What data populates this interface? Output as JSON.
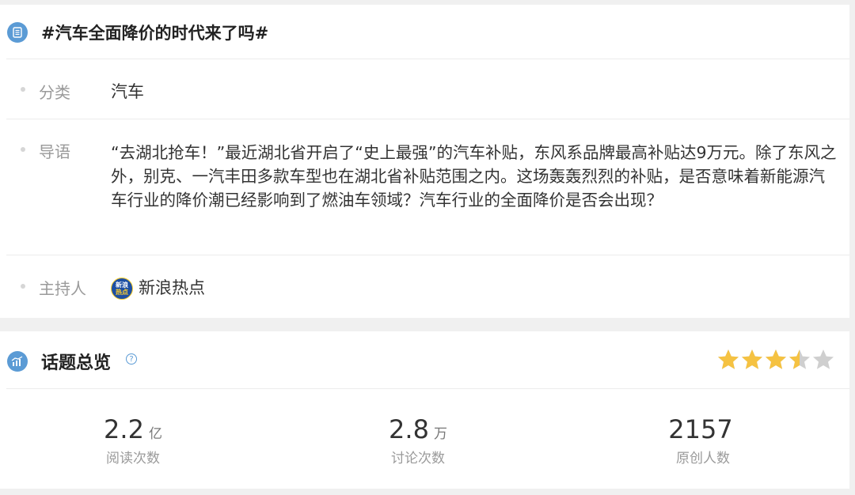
{
  "topic": {
    "title": "#汽车全面降价的时代来了吗#",
    "category_label": "分类",
    "category_value": "汽车",
    "intro_label": "导语",
    "intro_text": "“去湖北抢车！”最近湖北省开启了“史上最强”的汽车补贴，东风系品牌最高补贴达9万元。除了东风之外，别克、一汽丰田多款车型也在湖北省补贴范围之内。这场轰轰烈烈的补贴，是否意味着新能源汽车行业的降价潮已经影响到了燃油车领域？汽车行业的全面降价是否会出现？",
    "host_label": "主持人",
    "host_name": "新浪热点",
    "host_avatar_line1": "新浪",
    "host_avatar_line2": "热点"
  },
  "overview": {
    "title": "话题总览",
    "help_glyph": "?",
    "rating": 3.5,
    "rating_max": 5,
    "colors": {
      "star_on": "#f5c242",
      "star_off": "#cfcfcf",
      "accent": "#5b9bd5"
    },
    "stats": [
      {
        "value": "2.2",
        "unit": "亿",
        "label": "阅读次数"
      },
      {
        "value": "2.8",
        "unit": "万",
        "label": "讨论次数"
      },
      {
        "value": "2157",
        "unit": "",
        "label": "原创人数"
      }
    ]
  }
}
